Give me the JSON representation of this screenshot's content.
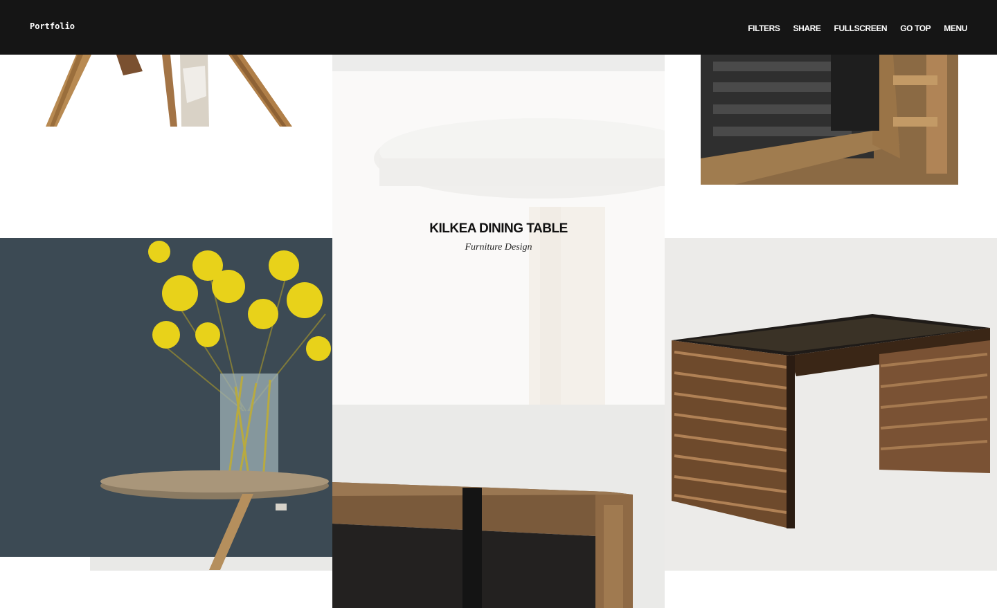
{
  "header": {
    "brand": "Portfolio",
    "nav": {
      "filters": "FILTERS",
      "share": "SHARE",
      "fullscreen": "FULLSCREEN",
      "go_top": "GO TOP",
      "menu": "MENU"
    }
  },
  "portfolio": {
    "featured": {
      "title": "KILKEA DINING TABLE",
      "category": "Furniture Design"
    }
  },
  "colors": {
    "header_bg": "#151515",
    "header_text": "#ffffff",
    "page_bg": "#ffffff"
  }
}
